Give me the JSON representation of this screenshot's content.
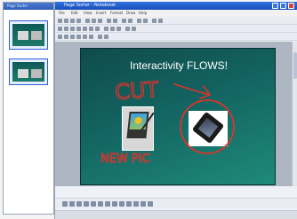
{
  "left_panel": {
    "title": "Page Sorter"
  },
  "window": {
    "title": "Page Sorter - Notebook",
    "menu": [
      "File",
      "Edit",
      "View",
      "Insert",
      "Format",
      "Draw",
      "Help"
    ]
  },
  "slide": {
    "title": "Interactivity FLOWS!",
    "annotations": {
      "cut": "CUT",
      "new_pic": "NEW PIC"
    }
  },
  "annotation_color": "#e0322a",
  "slide_bg": "#136462"
}
